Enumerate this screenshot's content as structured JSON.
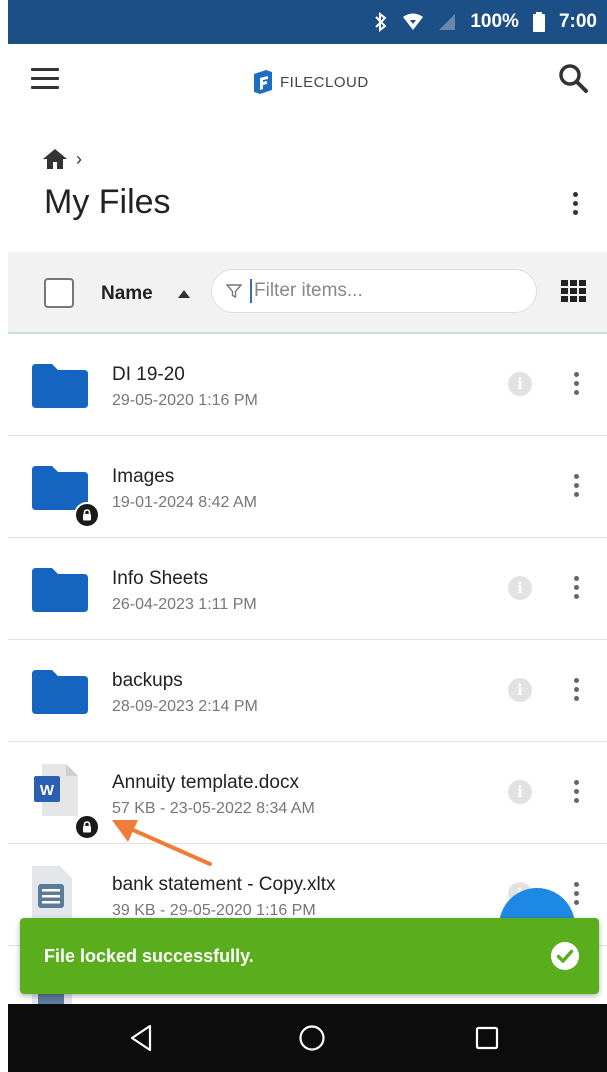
{
  "status_bar": {
    "battery": "100%",
    "time": "7:00"
  },
  "app": {
    "logo_text": "FILECLOUD"
  },
  "page": {
    "title": "My Files",
    "breadcrumb_separator": "›"
  },
  "toolbar": {
    "sort_label": "Name",
    "filter_placeholder": "Filter items..."
  },
  "files": [
    {
      "name": "DI 19-20",
      "meta": "29-05-2020 1:16 PM",
      "type": "folder",
      "locked": false
    },
    {
      "name": "Images",
      "meta": "19-01-2024 8:42 AM",
      "type": "folder",
      "locked": true
    },
    {
      "name": "Info Sheets",
      "meta": "26-04-2023 1:11 PM",
      "type": "folder",
      "locked": false
    },
    {
      "name": "backups",
      "meta": "28-09-2023 2:14 PM",
      "type": "folder",
      "locked": false
    },
    {
      "name": "Annuity template.docx",
      "meta": "57 KB - 23-05-2022 8:34 AM",
      "type": "word",
      "locked": true
    },
    {
      "name": "bank statement - Copy.xltx",
      "meta": "39 KB - 29-05-2020 1:16 PM",
      "type": "doc",
      "locked": false
    }
  ],
  "toast": {
    "message": "File locked successfully."
  },
  "colors": {
    "status_bar": "#1d4f87",
    "folder": "#1565c0",
    "toast": "#5aad1c",
    "fab": "#1e88e5",
    "annotation_arrow": "#f07c3a"
  }
}
